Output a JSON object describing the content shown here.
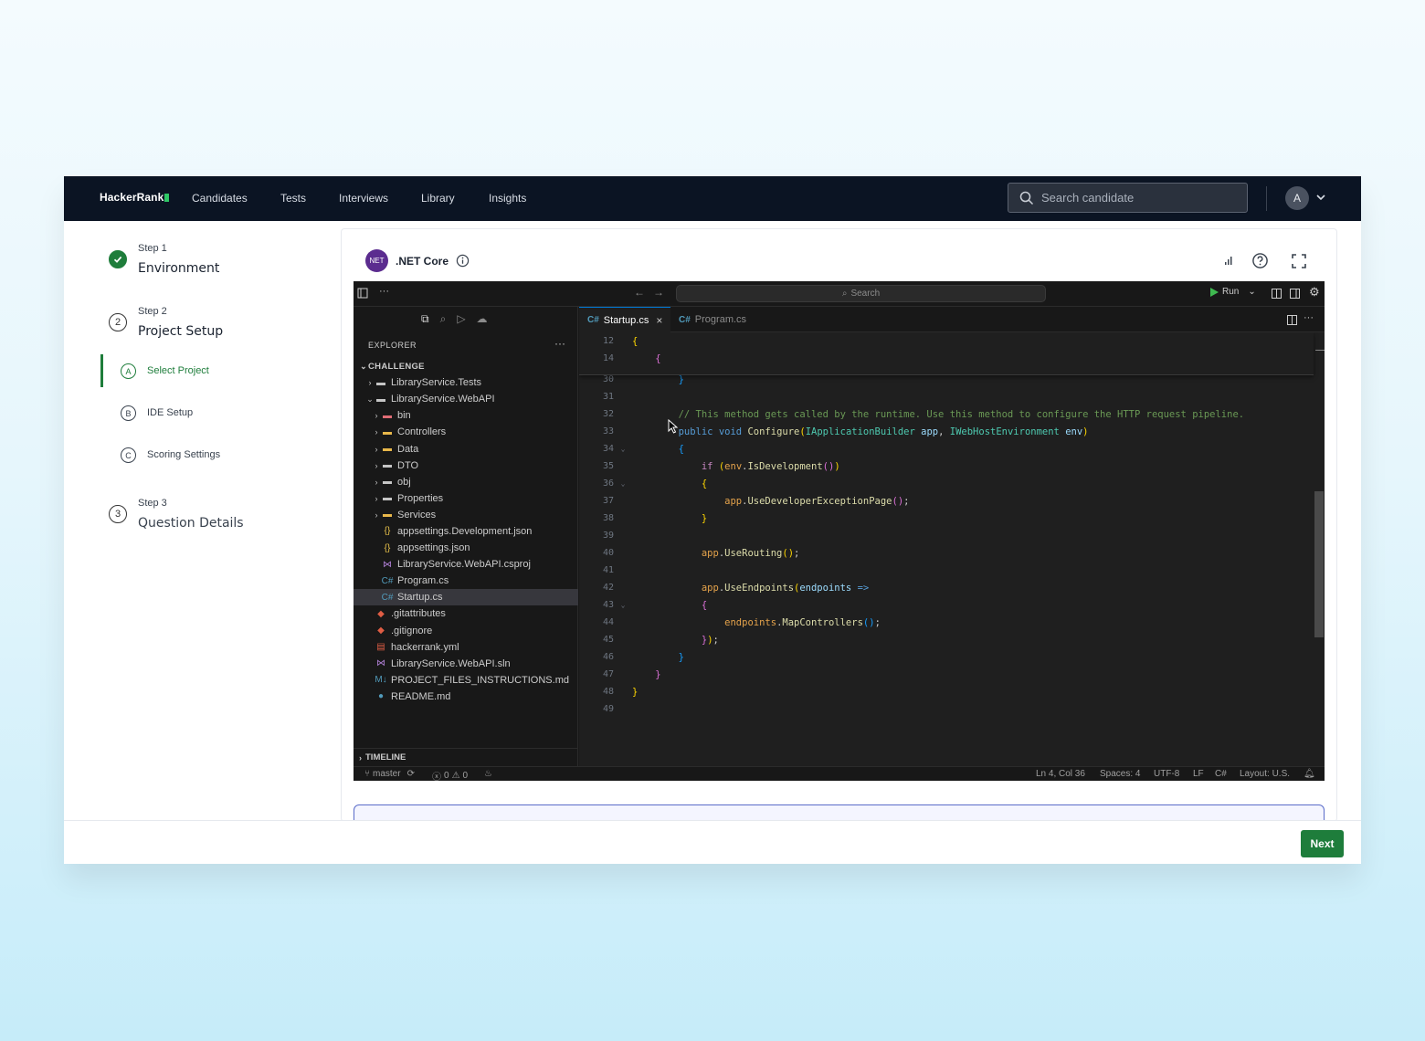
{
  "topnav": {
    "logo": "HackerRank",
    "links": [
      "Candidates",
      "Tests",
      "Interviews",
      "Library",
      "Insights"
    ],
    "search_placeholder": "Search candidate",
    "avatar_initial": "A"
  },
  "stepper": {
    "step1": {
      "label": "Step 1",
      "title": "Environment",
      "status": "done"
    },
    "step2": {
      "label": "Step 2",
      "title": "Project Setup",
      "number": "2"
    },
    "substeps": [
      {
        "letter": "A",
        "label": "Select Project",
        "active": true
      },
      {
        "letter": "B",
        "label": "IDE Setup"
      },
      {
        "letter": "C",
        "label": "Scoring Settings"
      }
    ],
    "step3": {
      "label": "Step 3",
      "title": "Question Details",
      "number": "3"
    }
  },
  "env": {
    "badge": ".NET Core",
    "badge_icon_text": "NET",
    "title": ".NET Core"
  },
  "ide": {
    "command_search": "Search",
    "run_label": "Run",
    "explorer_title": "EXPLORER",
    "tree": [
      {
        "label": "CHALLENGE",
        "depth": 0,
        "chev": "v",
        "type": "section"
      },
      {
        "label": "LibraryService.Tests",
        "depth": 1,
        "chev": ">",
        "type": "folder"
      },
      {
        "label": "LibraryService.WebAPI",
        "depth": 1,
        "chev": "v",
        "type": "folder-open"
      },
      {
        "label": "bin",
        "depth": 2,
        "chev": ">",
        "type": "folder-red"
      },
      {
        "label": "Controllers",
        "depth": 2,
        "chev": ">",
        "type": "folder-yellow"
      },
      {
        "label": "Data",
        "depth": 2,
        "chev": ">",
        "type": "folder-yellow"
      },
      {
        "label": "DTO",
        "depth": 2,
        "chev": ">",
        "type": "folder"
      },
      {
        "label": "obj",
        "depth": 2,
        "chev": ">",
        "type": "folder"
      },
      {
        "label": "Properties",
        "depth": 2,
        "chev": ">",
        "type": "folder"
      },
      {
        "label": "Services",
        "depth": 2,
        "chev": ">",
        "type": "folder-yellow"
      },
      {
        "label": "appsettings.Development.json",
        "depth": 2,
        "chev": "",
        "type": "json"
      },
      {
        "label": "appsettings.json",
        "depth": 2,
        "chev": "",
        "type": "json"
      },
      {
        "label": "LibraryService.WebAPI.csproj",
        "depth": 2,
        "chev": "",
        "type": "vs"
      },
      {
        "label": "Program.cs",
        "depth": 2,
        "chev": "",
        "type": "cs"
      },
      {
        "label": "Startup.cs",
        "depth": 2,
        "chev": "",
        "type": "cs",
        "selected": true
      },
      {
        "label": ".gitattributes",
        "depth": 1,
        "chev": "",
        "type": "git"
      },
      {
        "label": ".gitignore",
        "depth": 1,
        "chev": "",
        "type": "git"
      },
      {
        "label": "hackerrank.yml",
        "depth": 1,
        "chev": "",
        "type": "yml"
      },
      {
        "label": "LibraryService.WebAPI.sln",
        "depth": 1,
        "chev": "",
        "type": "vs"
      },
      {
        "label": "PROJECT_FILES_INSTRUCTIONS.md",
        "depth": 1,
        "chev": "",
        "type": "md"
      },
      {
        "label": "README.md",
        "depth": 1,
        "chev": "",
        "type": "info"
      }
    ],
    "timeline_label": "TIMELINE",
    "tabs": [
      {
        "icon": "C#",
        "label": "Startup.cs",
        "active": true,
        "close": "×"
      },
      {
        "icon": "C#",
        "label": "Program.cs",
        "active": false
      }
    ],
    "code_lines": [
      {
        "n": "31",
        "html": ""
      },
      {
        "n": "32",
        "html": "        <span class='cm'>// This method gets called by the runtime. Use this method to configure the HTTP request pipeline.</span>"
      },
      {
        "n": "33",
        "html": "        <span class='kw'>public</span> <span class='kw'>void</span> <span class='fn'>Configure</span><span class='b1'>(</span><span class='typ'>IApplicationBuilder</span> <span class='var'>app</span>, <span class='typ'>IWebHostEnvironment</span> <span class='var'>env</span><span class='b1'>)</span>"
      },
      {
        "n": "34",
        "fold": "v",
        "html": "        <span class='b3'>{</span>"
      },
      {
        "n": "35",
        "html": "            <span class='kw2'>if</span> <span class='b1'>(</span><span class='obj'>env</span>.<span class='fn'>IsDevelopment</span><span class='b2'>()</span><span class='b1'>)</span>"
      },
      {
        "n": "36",
        "fold": "v",
        "html": "            <span class='b1'>{</span>"
      },
      {
        "n": "37",
        "html": "                <span class='obj'>app</span>.<span class='fn'>UseDeveloperExceptionPage</span><span class='b2'>()</span>;"
      },
      {
        "n": "38",
        "html": "            <span class='b1'>}</span>"
      },
      {
        "n": "39",
        "html": ""
      },
      {
        "n": "40",
        "html": "            <span class='obj'>app</span>.<span class='fn'>UseRouting</span><span class='b1'>()</span>;"
      },
      {
        "n": "41",
        "html": ""
      },
      {
        "n": "42",
        "html": "            <span class='obj'>app</span>.<span class='fn'>UseEndpoints</span><span class='b1'>(</span><span class='var'>endpoints</span> <span class='kw'>=&gt;</span>"
      },
      {
        "n": "43",
        "fold": "v",
        "html": "            <span class='b2'>{</span>"
      },
      {
        "n": "44",
        "html": "                <span class='obj'>endpoints</span>.<span class='fn'>MapControllers</span><span class='b3'>()</span>;"
      },
      {
        "n": "45",
        "html": "            <span class='b2'>}</span><span class='b1'>)</span>;"
      },
      {
        "n": "46",
        "html": "        <span class='b3'>}</span>"
      },
      {
        "n": "47",
        "html": "    <span class='b2'>}</span>"
      },
      {
        "n": "48",
        "html": "<span class='b1'>}</span>"
      },
      {
        "n": "49",
        "html": ""
      }
    ],
    "sticky_lines": [
      {
        "n": "12",
        "html": "<span class='b1'>{</span>"
      },
      {
        "n": "14",
        "html": "    <span class='b2'>{</span>"
      }
    ],
    "line30": {
      "n": "30",
      "html": "        <span class='b3'>}</span>"
    },
    "status": {
      "branch": "master",
      "errors": "0",
      "warnings": "0",
      "position": "Ln 4, Col 36",
      "spaces": "Spaces: 4",
      "encoding": "UTF-8",
      "eol": "LF",
      "language": "C#",
      "layout": "Layout: U.S."
    }
  },
  "footer": {
    "next_label": "Next"
  },
  "colors": {
    "brand_green": "#1e7d3b",
    "nav_bg": "#0b1423",
    "ide_bg": "#1f1f1f"
  }
}
